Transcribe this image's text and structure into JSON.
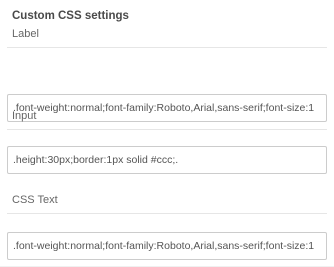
{
  "section": {
    "title": "Custom CSS settings"
  },
  "fields": {
    "label": {
      "label": "Label",
      "value": ".font-weight:normal;font-family:Roboto,Arial,sans-serif;font-size:1"
    },
    "input": {
      "label": "Input",
      "value": ".height:30px;border:1px solid #ccc;."
    },
    "css_text": {
      "label": "CSS Text",
      "value": ".font-weight:normal;font-family:Roboto,Arial,sans-serif;font-size:1"
    }
  }
}
